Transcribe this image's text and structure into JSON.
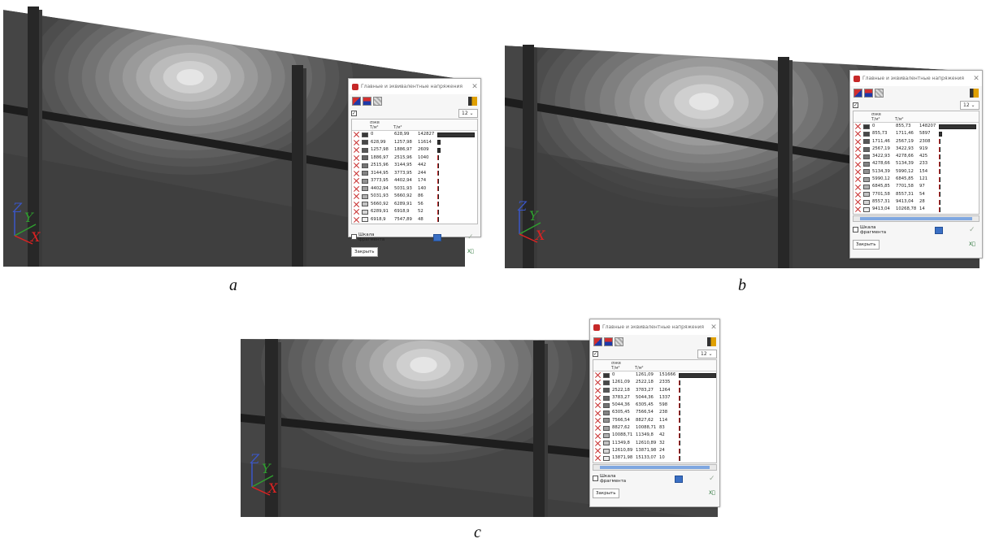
{
  "panels": [
    {
      "id": "a",
      "caption": "a",
      "dialog": {
        "title": "Главные и эквивалентные напряжения",
        "select_value": "12",
        "header": {
          "symbol": "σэкв",
          "unit1": "Т/м²",
          "unit2": "Т/м²"
        },
        "rows": [
          {
            "from": "0",
            "to": "628,99",
            "count": "142827",
            "frac": 1.0,
            "color": "#383838"
          },
          {
            "from": "628,99",
            "to": "1257,98",
            "count": "11614",
            "frac": 0.081,
            "color": "#484848"
          },
          {
            "from": "1257,98",
            "to": "1886,97",
            "count": "2609",
            "frac": 0.018,
            "color": "#585858"
          },
          {
            "from": "1886,97",
            "to": "2515,96",
            "count": "1040",
            "frac": 0,
            "color": "#666666"
          },
          {
            "from": "2515,96",
            "to": "3144,95",
            "count": "442",
            "frac": 0,
            "color": "#747474"
          },
          {
            "from": "3144,95",
            "to": "3773,95",
            "count": "244",
            "frac": 0,
            "color": "#838383"
          },
          {
            "from": "3773,95",
            "to": "4402,94",
            "count": "174",
            "frac": 0,
            "color": "#929292"
          },
          {
            "from": "4402,94",
            "to": "5031,93",
            "count": "140",
            "frac": 0,
            "color": "#a1a1a1"
          },
          {
            "from": "5031,93",
            "to": "5660,92",
            "count": "86",
            "frac": 0,
            "color": "#b1b1b1"
          },
          {
            "from": "5660,92",
            "to": "6289,91",
            "count": "56",
            "frac": 0,
            "color": "#c3c3c3"
          },
          {
            "from": "6289,91",
            "to": "6918,9",
            "count": "52",
            "frac": 0,
            "color": "#d6d6d6"
          },
          {
            "from": "6918,9",
            "to": "7547,89",
            "count": "48",
            "frac": 0,
            "color": "#eeeeee"
          }
        ],
        "scale_label": "Шкала фрагмента",
        "close_label": "Закрыть"
      }
    },
    {
      "id": "b",
      "caption": "b",
      "dialog": {
        "title": "Главные и эквивалентные напряжения",
        "select_value": "12",
        "header": {
          "symbol": "σэкв",
          "unit1": "Т/м²",
          "unit2": "Т/м²"
        },
        "rows": [
          {
            "from": "0",
            "to": "855,73",
            "count": "148207",
            "frac": 1.0,
            "color": "#383838"
          },
          {
            "from": "855,73",
            "to": "1711,46",
            "count": "5897",
            "frac": 0.04,
            "color": "#484848"
          },
          {
            "from": "1711,46",
            "to": "2567,19",
            "count": "2308",
            "frac": 0,
            "color": "#585858"
          },
          {
            "from": "2567,19",
            "to": "3422,93",
            "count": "919",
            "frac": 0,
            "color": "#666666"
          },
          {
            "from": "3422,93",
            "to": "4278,66",
            "count": "425",
            "frac": 0,
            "color": "#747474"
          },
          {
            "from": "4278,66",
            "to": "5134,39",
            "count": "233",
            "frac": 0,
            "color": "#838383"
          },
          {
            "from": "5134,39",
            "to": "5990,12",
            "count": "154",
            "frac": 0,
            "color": "#929292"
          },
          {
            "from": "5990,12",
            "to": "6845,85",
            "count": "121",
            "frac": 0,
            "color": "#a1a1a1"
          },
          {
            "from": "6845,85",
            "to": "7701,58",
            "count": "97",
            "frac": 0,
            "color": "#b1b1b1"
          },
          {
            "from": "7701,58",
            "to": "8557,31",
            "count": "54",
            "frac": 0,
            "color": "#c3c3c3"
          },
          {
            "from": "8557,31",
            "to": "9413,04",
            "count": "28",
            "frac": 0,
            "color": "#d6d6d6"
          },
          {
            "from": "9413,04",
            "to": "10268,78",
            "count": "14",
            "frac": 0,
            "color": "#eeeeee"
          }
        ],
        "scale_label": "Шкала фрагмента",
        "close_label": "Закрыть"
      }
    },
    {
      "id": "c",
      "caption": "c",
      "dialog": {
        "title": "Главные и эквивалентные напряжения",
        "select_value": "12",
        "header": {
          "symbol": "σэкв",
          "unit1": "Т/м²",
          "unit2": "Т/м²"
        },
        "rows": [
          {
            "from": "0",
            "to": "1261,09",
            "count": "151666",
            "frac": 1.0,
            "color": "#383838"
          },
          {
            "from": "1261,09",
            "to": "2522,18",
            "count": "2335",
            "frac": 0,
            "color": "#484848"
          },
          {
            "from": "2522,18",
            "to": "3783,27",
            "count": "1264",
            "frac": 0,
            "color": "#585858"
          },
          {
            "from": "3783,27",
            "to": "5044,36",
            "count": "1337",
            "frac": 0,
            "color": "#666666"
          },
          {
            "from": "5044,36",
            "to": "6305,45",
            "count": "598",
            "frac": 0,
            "color": "#747474"
          },
          {
            "from": "6305,45",
            "to": "7566,54",
            "count": "238",
            "frac": 0,
            "color": "#838383"
          },
          {
            "from": "7566,54",
            "to": "8827,62",
            "count": "114",
            "frac": 0,
            "color": "#929292"
          },
          {
            "from": "8827,62",
            "to": "10088,71",
            "count": "83",
            "frac": 0,
            "color": "#a1a1a1"
          },
          {
            "from": "10088,71",
            "to": "11349,8",
            "count": "42",
            "frac": 0,
            "color": "#b1b1b1"
          },
          {
            "from": "11349,8",
            "to": "12610,89",
            "count": "32",
            "frac": 0,
            "color": "#c3c3c3"
          },
          {
            "from": "12610,89",
            "to": "13871,98",
            "count": "24",
            "frac": 0,
            "color": "#d6d6d6"
          },
          {
            "from": "13871,98",
            "to": "15133,07",
            "count": "10",
            "frac": 0,
            "color": "#eeeeee"
          }
        ],
        "scale_label": "Шкала фрагмента",
        "close_label": "Закрыть"
      }
    }
  ],
  "axes": {
    "z": "Z",
    "y": "Y",
    "x": "X",
    "z_color": "#3a56c8",
    "y_color": "#2f9e2f",
    "x_color": "#d22"
  }
}
